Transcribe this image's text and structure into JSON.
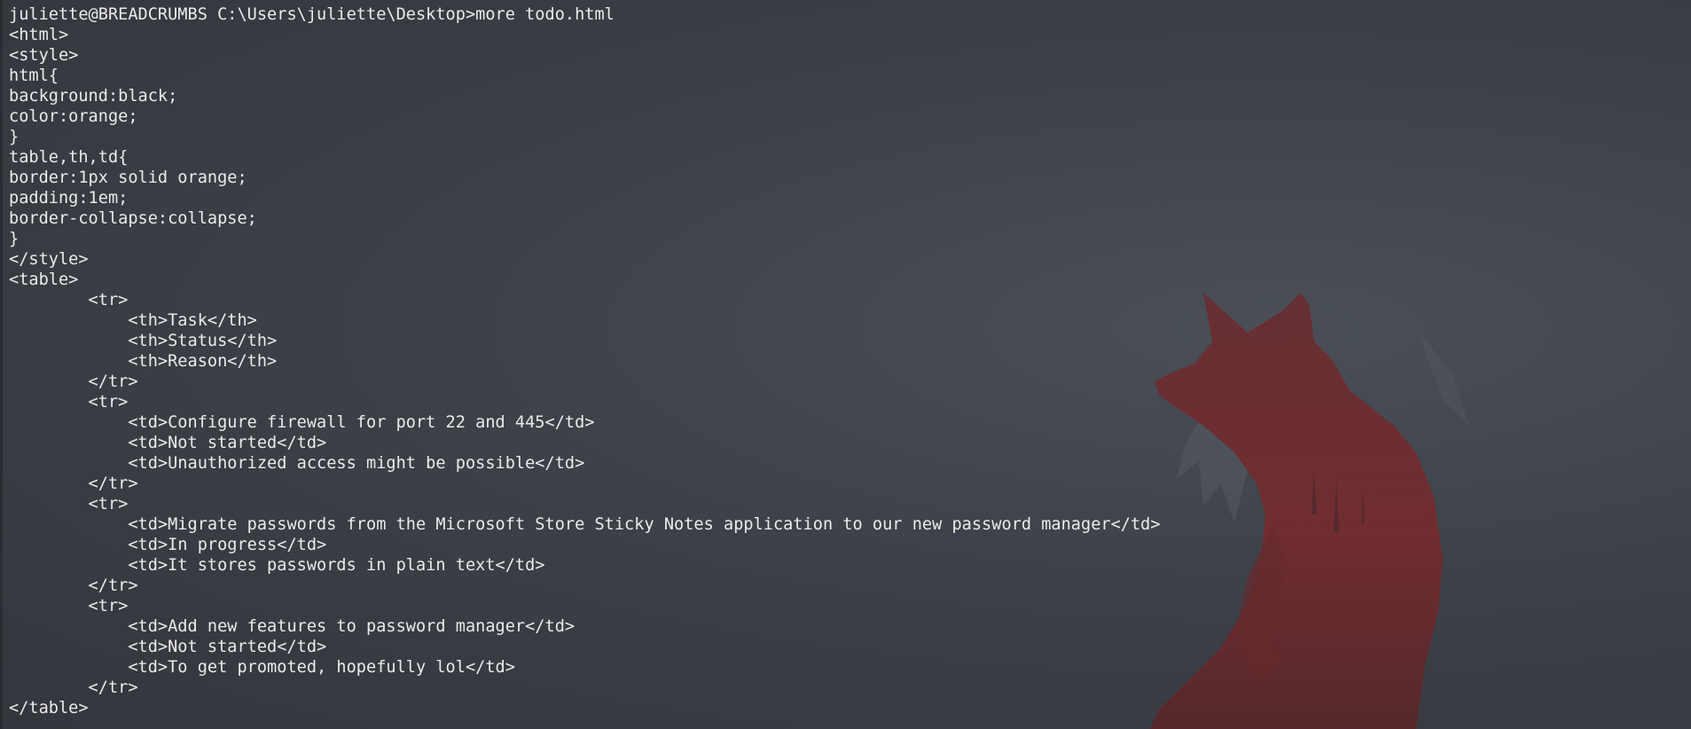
{
  "terminal": {
    "prompt": "juliette@BREADCRUMBS C:\\Users\\juliette\\Desktop>",
    "command": "more todo.html",
    "output_lines": [
      "<html>",
      "<style>",
      "html{",
      "background:black;",
      "color:orange;",
      "}",
      "table,th,td{",
      "border:1px solid orange;",
      "padding:1em;",
      "border-collapse:collapse;",
      "}",
      "</style>",
      "<table>",
      "        <tr>",
      "            <th>Task</th>",
      "            <th>Status</th>",
      "            <th>Reason</th>",
      "        </tr>",
      "        <tr>",
      "            <td>Configure firewall for port 22 and 445</td>",
      "            <td>Not started</td>",
      "            <td>Unauthorized access might be possible</td>",
      "        </tr>",
      "        <tr>",
      "            <td>Migrate passwords from the Microsoft Store Sticky Notes application to our new password manager</td>",
      "            <td>In progress</td>",
      "            <td>It stores passwords in plain text</td>",
      "        </tr>",
      "        <tr>",
      "            <td>Add new features to password manager</td>",
      "            <td>Not started</td>",
      "            <td>To get promoted, hopefully lol</td>",
      "        </tr>",
      "</table>"
    ]
  },
  "wallpaper": {
    "icon": "fox-silhouette-icon",
    "color": "#7a2a2c"
  }
}
